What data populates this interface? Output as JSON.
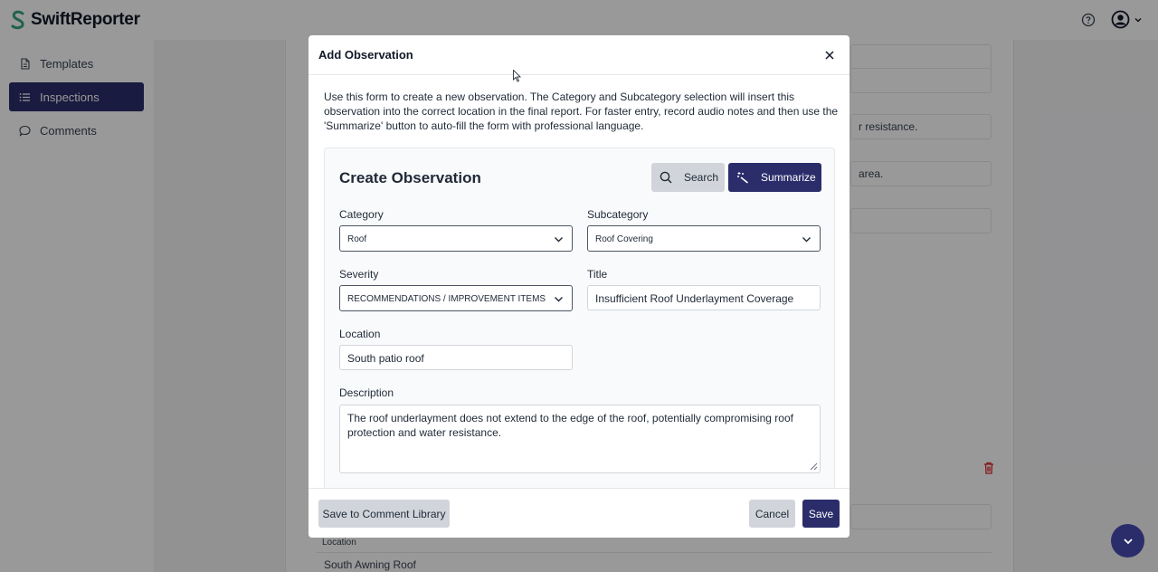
{
  "app": {
    "name": "SwiftReporter",
    "icons": {
      "help": "help-circle-icon",
      "user": "user-circle-icon",
      "user_menu": "chevron-down-icon"
    }
  },
  "sidebar": {
    "items": [
      {
        "label": "Templates",
        "icon": "document-icon",
        "active": false
      },
      {
        "label": "Inspections",
        "icon": "list-icon",
        "active": true
      },
      {
        "label": "Comments",
        "icon": "chat-bubble-icon",
        "active": false
      }
    ]
  },
  "background": {
    "snippet_1": "r resistance.",
    "snippet_2": "area.",
    "location_label": "Location",
    "location_value": "South Awning Roof"
  },
  "modal": {
    "title": "Add Observation",
    "description": "Use this form to create a new observation. The Category and Subcategory selection will insert this observation into the correct location in the final report. For faster entry, record audio notes and then use the 'Summarize' button to auto-fill the form with professional language.",
    "form": {
      "heading": "Create Observation",
      "search_label": "Search",
      "summarize_label": "Summarize",
      "category": {
        "label": "Category",
        "value": "Roof"
      },
      "subcategory": {
        "label": "Subcategory",
        "value": "Roof Covering"
      },
      "severity": {
        "label": "Severity",
        "value": "RECOMMENDATIONS / IMPROVEMENT ITEMS"
      },
      "title": {
        "label": "Title",
        "value": "Insufficient Roof Underlayment Coverage"
      },
      "location": {
        "label": "Location",
        "value": "South patio roof"
      },
      "description": {
        "label": "Description",
        "value": "The roof underlayment does not extend to the edge of the roof, potentially compromising roof protection and water resistance."
      }
    },
    "footer": {
      "library_label": "Save to Comment Library",
      "cancel_label": "Cancel",
      "save_label": "Save"
    }
  },
  "colors": {
    "primary": "#2b2d6b",
    "danger": "#dc2626",
    "brand_mark": "#3aa37d"
  }
}
